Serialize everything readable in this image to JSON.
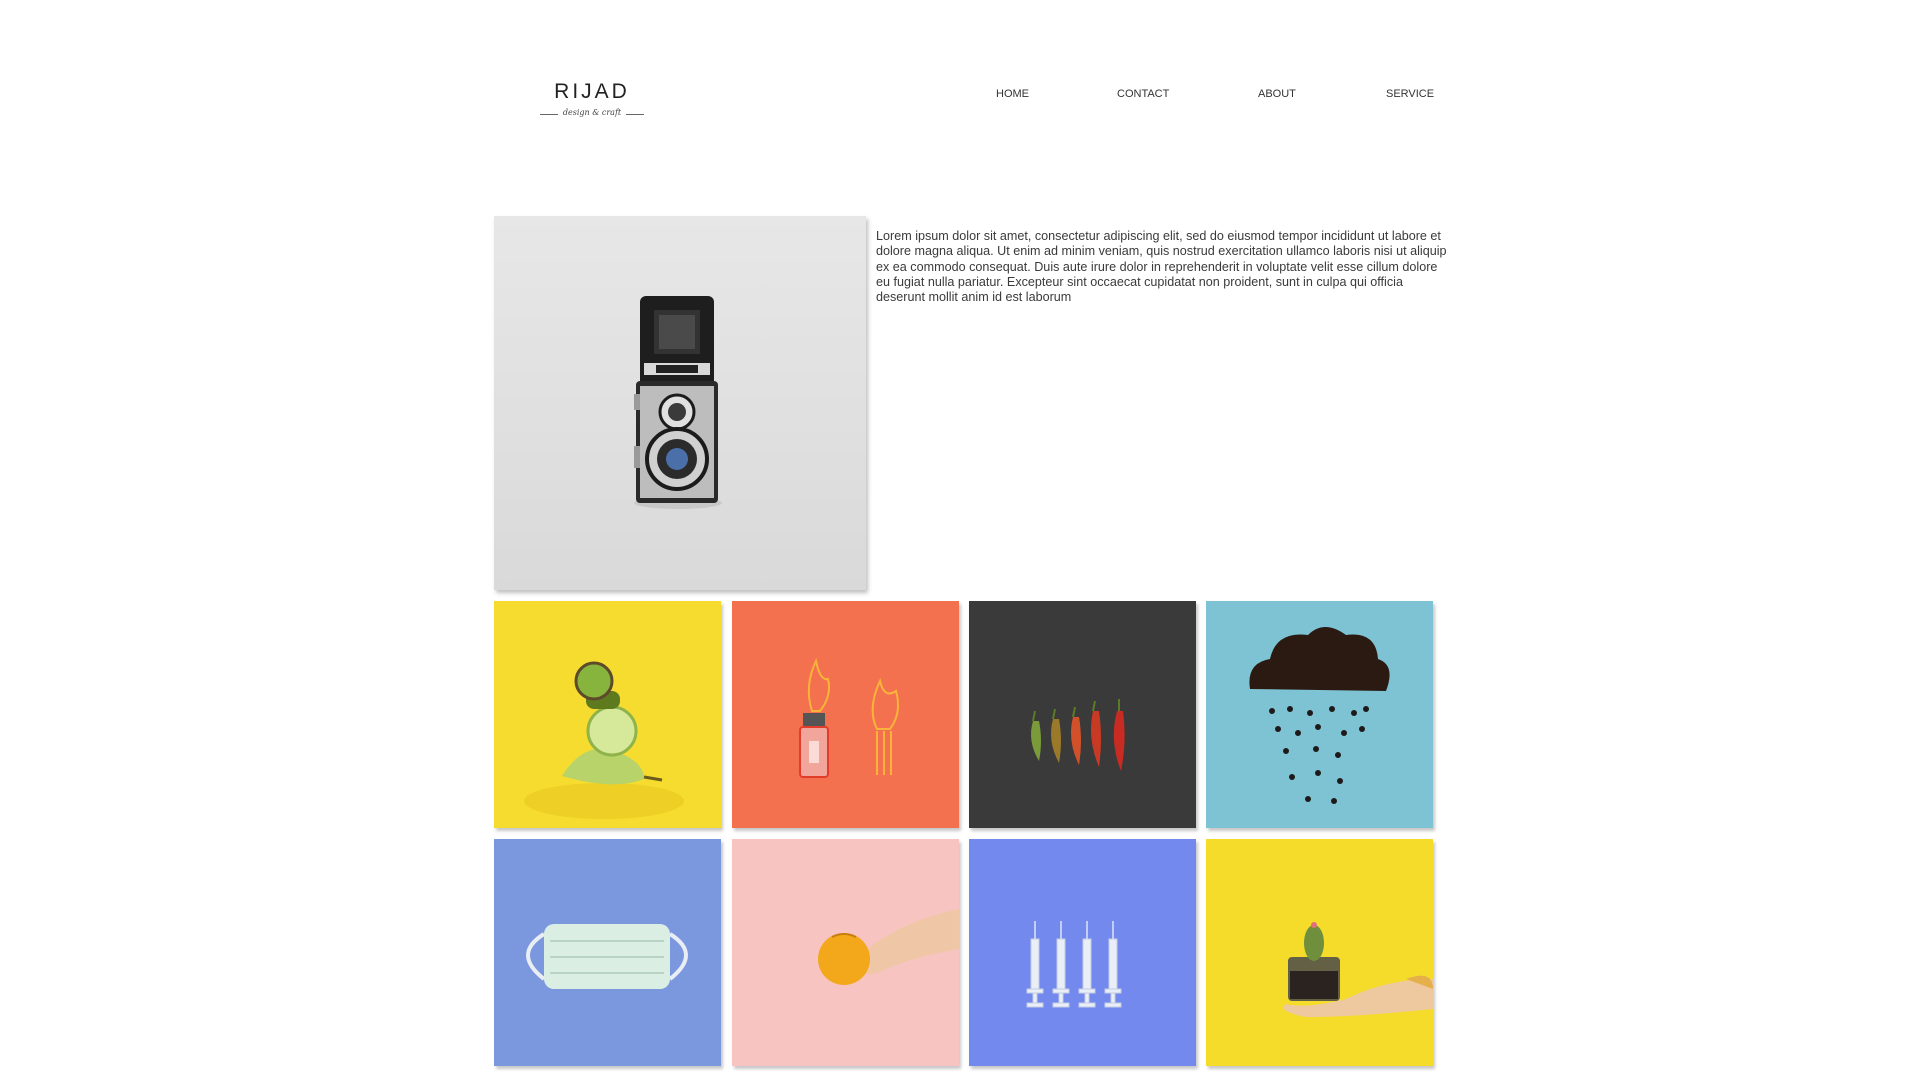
{
  "header": {
    "logo": {
      "name": "RIJAD",
      "tagline": "design & craft"
    },
    "nav": [
      {
        "label": "HOME"
      },
      {
        "label": "CONTACT"
      },
      {
        "label": "ABOUT"
      },
      {
        "label": "SERVICE"
      }
    ]
  },
  "hero": {
    "image": "vintage-camera-photo",
    "text": "Lorem ipsum dolor sit amet, consectetur adipiscing elit, sed do eiusmod tempor incididunt ut labore et dolore magna aliqua. Ut enim ad minim veniam, quis nostrud exercitation ullamco laboris nisi ut aliquip ex ea commodo consequat. Duis aute irure dolor in reprehenderit in voluptate velit esse cillum dolore eu fugiat nulla pariatur. Excepteur sint occaecat cupidatat non proident, sunt in culpa qui officia deserunt mollit anim id est laborum"
  },
  "gallery": [
    {
      "image": "kiwi-lime-pear-stack",
      "bg": "#f5dc2e"
    },
    {
      "image": "lighter-and-matches",
      "bg": "#f3714f"
    },
    {
      "image": "chili-peppers",
      "bg": "#3a3a3a"
    },
    {
      "image": "coffee-bean-rain-cloud",
      "bg": "#7ec3d3"
    },
    {
      "image": "face-mask",
      "bg": "#7b97de"
    },
    {
      "image": "hand-holding-orange",
      "bg": "#f7c4c2"
    },
    {
      "image": "syringes",
      "bg": "#7389ee"
    },
    {
      "image": "hand-holding-cactus",
      "bg": "#f6dc2a"
    }
  ]
}
